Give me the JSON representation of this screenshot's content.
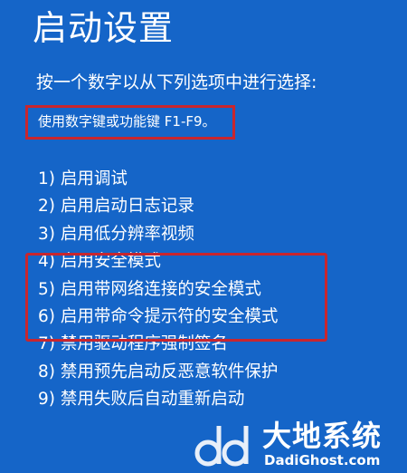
{
  "title": "启动设置",
  "instruction": "按一个数字以从下列选项中进行选择:",
  "hint": "使用数字键或功能键 F1-F9。",
  "options": [
    "1) 启用调试",
    "2) 启用启动日志记录",
    "3) 启用低分辨率视频",
    "4) 启用安全模式",
    "5) 启用带网络连接的安全模式",
    "6) 启用带命令提示符的安全模式",
    "7) 禁用驱动程序强制签名",
    "8) 禁用预先启动反恶意软件保护",
    "9) 禁用失败后自动重新启动"
  ],
  "watermark": {
    "name": "大地系统",
    "site": "DadiGhost.com",
    "icon": "dd-logo-icon"
  },
  "colors": {
    "background": "#1565c8",
    "text": "#ffffff",
    "highlight_border": "#c8262e"
  }
}
